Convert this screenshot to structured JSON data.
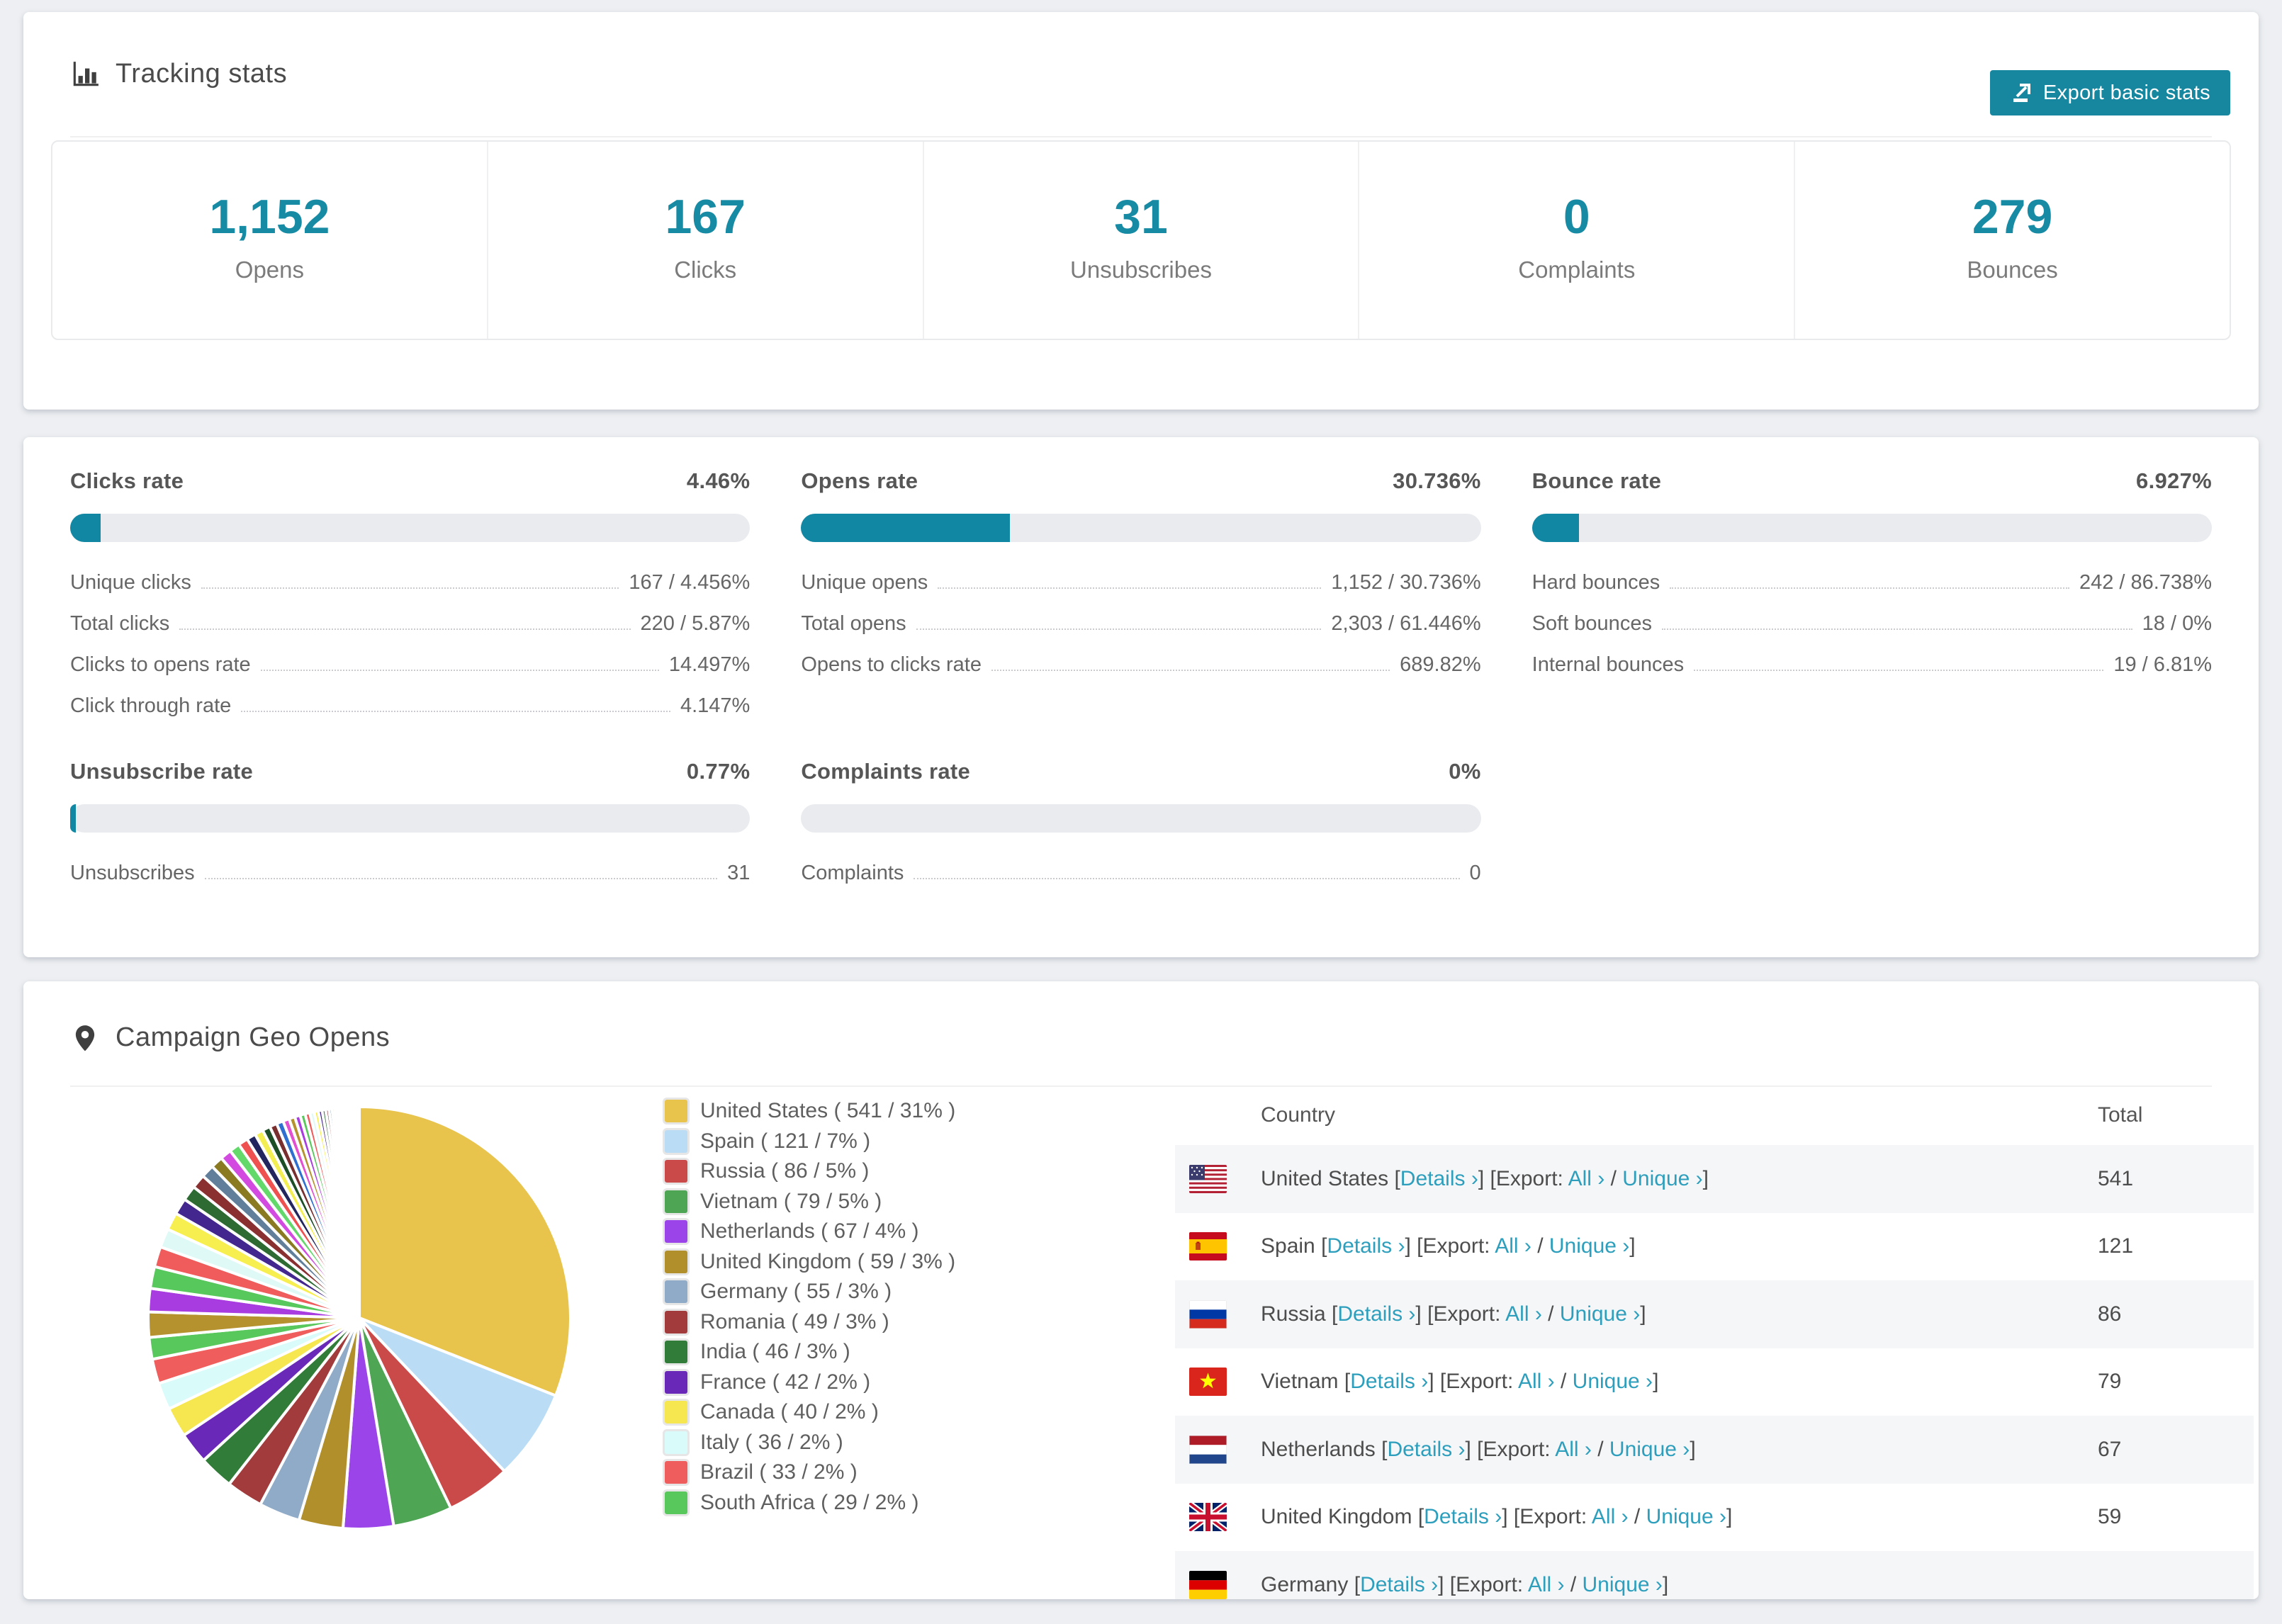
{
  "page": {
    "background": "#edeff2",
    "accent_teal": "#178aa4",
    "bar_fill": "#1187a3",
    "link_color": "#2d9fbd"
  },
  "tracking": {
    "title": "Tracking stats",
    "export_button": "Export basic stats",
    "stats": [
      {
        "value": "1,152",
        "label": "Opens"
      },
      {
        "value": "167",
        "label": "Clicks"
      },
      {
        "value": "31",
        "label": "Unsubscribes"
      },
      {
        "value": "0",
        "label": "Complaints"
      },
      {
        "value": "279",
        "label": "Bounces"
      }
    ]
  },
  "rates": [
    {
      "name": "Clicks rate",
      "value": "4.46%",
      "bar_pct": 4.46,
      "rows": [
        {
          "label": "Unique clicks",
          "value": "167 / 4.456%"
        },
        {
          "label": "Total clicks",
          "value": "220 / 5.87%"
        },
        {
          "label": "Clicks to opens rate",
          "value": "14.497%"
        },
        {
          "label": "Click through rate",
          "value": "4.147%"
        }
      ]
    },
    {
      "name": "Opens rate",
      "value": "30.736%",
      "bar_pct": 30.736,
      "rows": [
        {
          "label": "Unique opens",
          "value": "1,152 / 30.736%"
        },
        {
          "label": "Total opens",
          "value": "2,303 / 61.446%"
        },
        {
          "label": "Opens to clicks rate",
          "value": "689.82%"
        }
      ]
    },
    {
      "name": "Bounce rate",
      "value": "6.927%",
      "bar_pct": 6.927,
      "rows": [
        {
          "label": "Hard bounces",
          "value": "242 / 86.738%"
        },
        {
          "label": "Soft bounces",
          "value": "18 / 0%"
        },
        {
          "label": "Internal bounces",
          "value": "19 / 6.81%"
        }
      ]
    },
    {
      "name": "Unsubscribe rate",
      "value": "0.77%",
      "bar_pct": 0.77,
      "rows": [
        {
          "label": "Unsubscribes",
          "value": "31"
        }
      ]
    },
    {
      "name": "Complaints rate",
      "value": "0%",
      "bar_pct": 0,
      "rows": [
        {
          "label": "Complaints",
          "value": "0"
        }
      ]
    }
  ],
  "chart_data": {
    "type": "pie",
    "title": "Campaign Geo Opens",
    "legend_position": "right",
    "start_angle_deg": -90,
    "direction": "clockwise",
    "slices": [
      {
        "label": "United States",
        "value": 541,
        "pct": 31,
        "color": "#e8c44d"
      },
      {
        "label": "Spain",
        "value": 121,
        "pct": 7,
        "color": "#badcf5"
      },
      {
        "label": "Russia",
        "value": 86,
        "pct": 5,
        "color": "#ca4a4a"
      },
      {
        "label": "Vietnam",
        "value": 79,
        "pct": 5,
        "color": "#4ea553"
      },
      {
        "label": "Netherlands",
        "value": 67,
        "pct": 4,
        "color": "#9b44ea"
      },
      {
        "label": "United Kingdom",
        "value": 59,
        "pct": 3,
        "color": "#b1902c"
      },
      {
        "label": "Germany",
        "value": 55,
        "pct": 3,
        "color": "#90abc7"
      },
      {
        "label": "Romania",
        "value": 49,
        "pct": 3,
        "color": "#a23c3c"
      },
      {
        "label": "India",
        "value": 46,
        "pct": 3,
        "color": "#307c38"
      },
      {
        "label": "France",
        "value": 42,
        "pct": 2,
        "color": "#6a28b8"
      },
      {
        "label": "Canada",
        "value": 40,
        "pct": 2,
        "color": "#f6e64f"
      },
      {
        "label": "Italy",
        "value": 36,
        "pct": 2,
        "color": "#d9fbfa"
      },
      {
        "label": "Brazil",
        "value": 33,
        "pct": 2,
        "color": "#f05d5d"
      },
      {
        "label": "South Africa",
        "value": 29,
        "pct": 2,
        "color": "#58c85c"
      }
    ],
    "others": {
      "pct_total": 26,
      "value_estimate": 462,
      "slice_count": 45,
      "decay": 0.93,
      "palette": [
        "#b5922e",
        "#a93ce0",
        "#57c85b",
        "#f05c5c",
        "#dffaf6",
        "#f7ee4f",
        "#43268e",
        "#2e6b33",
        "#8a3030",
        "#617e9b",
        "#8a7a22",
        "#d24ae0",
        "#62d96a",
        "#ef5050",
        "#23265e",
        "#f3ef52",
        "#1d4f26",
        "#7a2f2f",
        "#2f6fd0",
        "#e24fd0"
      ]
    }
  },
  "geo": {
    "title": "Campaign Geo Opens",
    "table": {
      "headers": [
        "Country",
        "Total"
      ],
      "links": {
        "details": "Details",
        "export_prefix": "Export:",
        "all": "All",
        "unique": "Unique",
        "chevron": "›"
      },
      "rows": [
        {
          "country": "United States",
          "total": "541",
          "flag": "us"
        },
        {
          "country": "Spain",
          "total": "121",
          "flag": "es"
        },
        {
          "country": "Russia",
          "total": "86",
          "flag": "ru"
        },
        {
          "country": "Vietnam",
          "total": "79",
          "flag": "vn"
        },
        {
          "country": "Netherlands",
          "total": "67",
          "flag": "nl"
        },
        {
          "country": "United Kingdom",
          "total": "59",
          "flag": "gb"
        },
        {
          "country": "Germany",
          "total": "",
          "flag": "de"
        }
      ]
    }
  }
}
